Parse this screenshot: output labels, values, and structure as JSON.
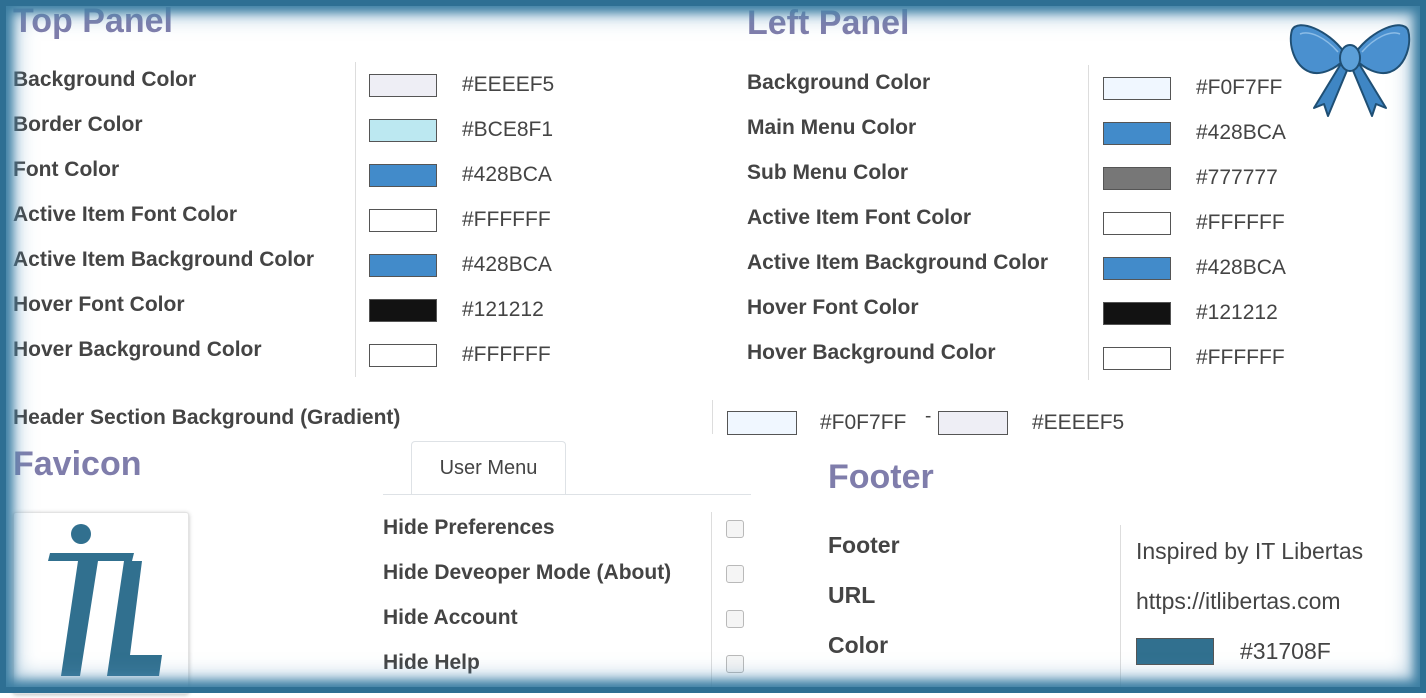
{
  "top_panel": {
    "title": "Top Panel",
    "rows": [
      {
        "label": "Background Color",
        "hex": "#EEEEF5",
        "color": "#EEEEF5"
      },
      {
        "label": "Border Color",
        "hex": "#BCE8F1",
        "color": "#BCE8F1"
      },
      {
        "label": "Font Color",
        "hex": "#428BCA",
        "color": "#428BCA"
      },
      {
        "label": "Active Item Font Color",
        "hex": "#FFFFFF",
        "color": "#FFFFFF"
      },
      {
        "label": "Active Item Background Color",
        "hex": "#428BCA",
        "color": "#428BCA"
      },
      {
        "label": "Hover Font Color",
        "hex": "#121212",
        "color": "#121212"
      },
      {
        "label": "Hover Background Color",
        "hex": "#FFFFFF",
        "color": "#FFFFFF"
      }
    ]
  },
  "left_panel": {
    "title": "Left Panel",
    "rows": [
      {
        "label": "Background Color",
        "hex": "#F0F7FF",
        "color": "#F0F7FF"
      },
      {
        "label": "Main Menu Color",
        "hex": "#428BCA",
        "color": "#428BCA"
      },
      {
        "label": "Sub Menu Color",
        "hex": "#777777",
        "color": "#777777"
      },
      {
        "label": "Active Item Font Color",
        "hex": "#FFFFFF",
        "color": "#FFFFFF"
      },
      {
        "label": "Active Item Background Color",
        "hex": "#428BCA",
        "color": "#428BCA"
      },
      {
        "label": "Hover Font Color",
        "hex": "#121212",
        "color": "#121212"
      },
      {
        "label": "Hover Background Color",
        "hex": "#FFFFFF",
        "color": "#FFFFFF"
      }
    ]
  },
  "header_section": {
    "label": "Header Section Background (Gradient)",
    "start_hex": "#F0F7FF",
    "start_color": "#F0F7FF",
    "separator": "-",
    "end_hex": "#EEEEF5",
    "end_color": "#EEEEF5"
  },
  "favicon": {
    "title": "Favicon",
    "logo_icon": "itl-logo-icon",
    "logo_color": "#31708F"
  },
  "user_menu": {
    "tab_label": "User Menu",
    "items": [
      {
        "label": "Hide Preferences",
        "checked": false
      },
      {
        "label": "Hide Deveoper Mode (About)",
        "checked": false
      },
      {
        "label": "Hide Account",
        "checked": false
      },
      {
        "label": "Hide Help",
        "checked": false
      }
    ]
  },
  "footer": {
    "title": "Footer",
    "footer_label": "Footer",
    "footer_value": "Inspired by IT Libertas",
    "url_label": "URL",
    "url_value": "https://itlibertas.com",
    "color_label": "Color",
    "color_hex": "#31708F",
    "color": "#31708F"
  },
  "decoration": {
    "bow_icon": "ribbon-bow-icon",
    "frame_color": "#2E6F93",
    "heading_color": "#7F7DAB"
  }
}
